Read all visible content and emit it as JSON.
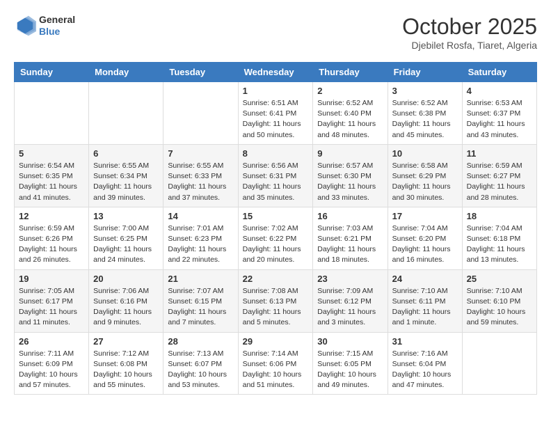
{
  "logo": {
    "line1": "General",
    "line2": "Blue"
  },
  "header": {
    "title": "October 2025",
    "subtitle": "Djebilet Rosfa, Tiaret, Algeria"
  },
  "weekdays": [
    "Sunday",
    "Monday",
    "Tuesday",
    "Wednesday",
    "Thursday",
    "Friday",
    "Saturday"
  ],
  "weeks": [
    [
      {
        "day": "",
        "info": ""
      },
      {
        "day": "",
        "info": ""
      },
      {
        "day": "",
        "info": ""
      },
      {
        "day": "1",
        "info": "Sunrise: 6:51 AM\nSunset: 6:41 PM\nDaylight: 11 hours\nand 50 minutes."
      },
      {
        "day": "2",
        "info": "Sunrise: 6:52 AM\nSunset: 6:40 PM\nDaylight: 11 hours\nand 48 minutes."
      },
      {
        "day": "3",
        "info": "Sunrise: 6:52 AM\nSunset: 6:38 PM\nDaylight: 11 hours\nand 45 minutes."
      },
      {
        "day": "4",
        "info": "Sunrise: 6:53 AM\nSunset: 6:37 PM\nDaylight: 11 hours\nand 43 minutes."
      }
    ],
    [
      {
        "day": "5",
        "info": "Sunrise: 6:54 AM\nSunset: 6:35 PM\nDaylight: 11 hours\nand 41 minutes."
      },
      {
        "day": "6",
        "info": "Sunrise: 6:55 AM\nSunset: 6:34 PM\nDaylight: 11 hours\nand 39 minutes."
      },
      {
        "day": "7",
        "info": "Sunrise: 6:55 AM\nSunset: 6:33 PM\nDaylight: 11 hours\nand 37 minutes."
      },
      {
        "day": "8",
        "info": "Sunrise: 6:56 AM\nSunset: 6:31 PM\nDaylight: 11 hours\nand 35 minutes."
      },
      {
        "day": "9",
        "info": "Sunrise: 6:57 AM\nSunset: 6:30 PM\nDaylight: 11 hours\nand 33 minutes."
      },
      {
        "day": "10",
        "info": "Sunrise: 6:58 AM\nSunset: 6:29 PM\nDaylight: 11 hours\nand 30 minutes."
      },
      {
        "day": "11",
        "info": "Sunrise: 6:59 AM\nSunset: 6:27 PM\nDaylight: 11 hours\nand 28 minutes."
      }
    ],
    [
      {
        "day": "12",
        "info": "Sunrise: 6:59 AM\nSunset: 6:26 PM\nDaylight: 11 hours\nand 26 minutes."
      },
      {
        "day": "13",
        "info": "Sunrise: 7:00 AM\nSunset: 6:25 PM\nDaylight: 11 hours\nand 24 minutes."
      },
      {
        "day": "14",
        "info": "Sunrise: 7:01 AM\nSunset: 6:23 PM\nDaylight: 11 hours\nand 22 minutes."
      },
      {
        "day": "15",
        "info": "Sunrise: 7:02 AM\nSunset: 6:22 PM\nDaylight: 11 hours\nand 20 minutes."
      },
      {
        "day": "16",
        "info": "Sunrise: 7:03 AM\nSunset: 6:21 PM\nDaylight: 11 hours\nand 18 minutes."
      },
      {
        "day": "17",
        "info": "Sunrise: 7:04 AM\nSunset: 6:20 PM\nDaylight: 11 hours\nand 16 minutes."
      },
      {
        "day": "18",
        "info": "Sunrise: 7:04 AM\nSunset: 6:18 PM\nDaylight: 11 hours\nand 13 minutes."
      }
    ],
    [
      {
        "day": "19",
        "info": "Sunrise: 7:05 AM\nSunset: 6:17 PM\nDaylight: 11 hours\nand 11 minutes."
      },
      {
        "day": "20",
        "info": "Sunrise: 7:06 AM\nSunset: 6:16 PM\nDaylight: 11 hours\nand 9 minutes."
      },
      {
        "day": "21",
        "info": "Sunrise: 7:07 AM\nSunset: 6:15 PM\nDaylight: 11 hours\nand 7 minutes."
      },
      {
        "day": "22",
        "info": "Sunrise: 7:08 AM\nSunset: 6:13 PM\nDaylight: 11 hours\nand 5 minutes."
      },
      {
        "day": "23",
        "info": "Sunrise: 7:09 AM\nSunset: 6:12 PM\nDaylight: 11 hours\nand 3 minutes."
      },
      {
        "day": "24",
        "info": "Sunrise: 7:10 AM\nSunset: 6:11 PM\nDaylight: 11 hours\nand 1 minute."
      },
      {
        "day": "25",
        "info": "Sunrise: 7:10 AM\nSunset: 6:10 PM\nDaylight: 10 hours\nand 59 minutes."
      }
    ],
    [
      {
        "day": "26",
        "info": "Sunrise: 7:11 AM\nSunset: 6:09 PM\nDaylight: 10 hours\nand 57 minutes."
      },
      {
        "day": "27",
        "info": "Sunrise: 7:12 AM\nSunset: 6:08 PM\nDaylight: 10 hours\nand 55 minutes."
      },
      {
        "day": "28",
        "info": "Sunrise: 7:13 AM\nSunset: 6:07 PM\nDaylight: 10 hours\nand 53 minutes."
      },
      {
        "day": "29",
        "info": "Sunrise: 7:14 AM\nSunset: 6:06 PM\nDaylight: 10 hours\nand 51 minutes."
      },
      {
        "day": "30",
        "info": "Sunrise: 7:15 AM\nSunset: 6:05 PM\nDaylight: 10 hours\nand 49 minutes."
      },
      {
        "day": "31",
        "info": "Sunrise: 7:16 AM\nSunset: 6:04 PM\nDaylight: 10 hours\nand 47 minutes."
      },
      {
        "day": "",
        "info": ""
      }
    ]
  ]
}
